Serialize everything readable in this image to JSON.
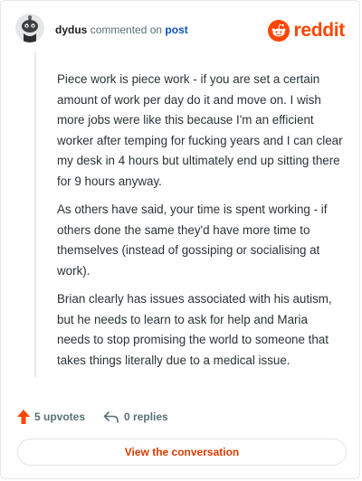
{
  "header": {
    "username": "dydus",
    "commented_text": "commented on",
    "post_link": "post",
    "brand": "reddit",
    "avatar_icon": "snoo-avatar-icon",
    "brand_icon": "reddit-logo-icon"
  },
  "comment": {
    "paragraphs": [
      "Piece work is piece work - if you are set a certain amount of work per day do it and move on. I wish more jobs were like this because I'm an efficient worker after temping for fucking years and I can clear my desk in 4 hours but ultimately end up sitting there for 9 hours anyway.",
      "As others have said, your time is spent working - if others done the same they'd have more time to themselves (instead of gossiping or socialising at work).",
      "Brian clearly has issues associated with his autism, but he needs to learn to ask for help and Maria needs to stop promising the world to someone that takes things literally due to a medical issue."
    ]
  },
  "actions": {
    "upvotes": "5 upvotes",
    "replies": "0 replies",
    "upvote_icon": "upvote-arrow-icon",
    "reply_icon": "reply-arrow-icon"
  },
  "cta": {
    "label": "View the conversation"
  },
  "colors": {
    "brand": "#ff4500",
    "link": "#0a53be",
    "cta_text": "#d93a00",
    "muted": "#576f76"
  }
}
